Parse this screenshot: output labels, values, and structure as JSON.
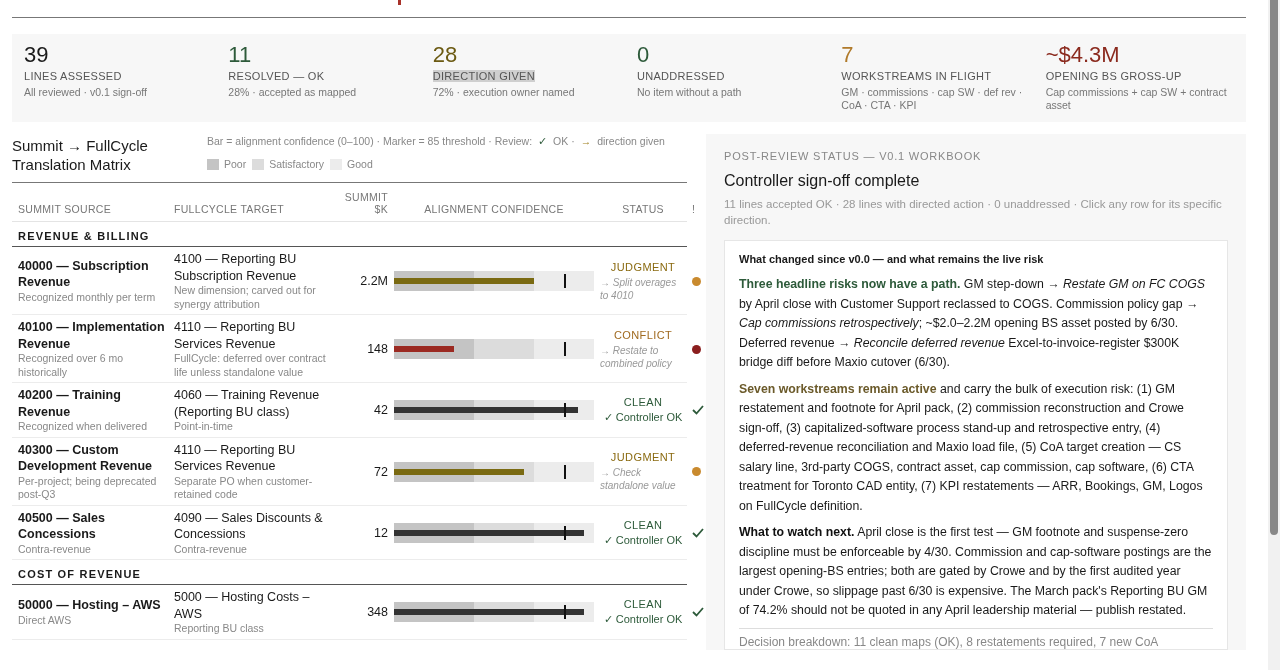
{
  "kpis": [
    {
      "value": "39",
      "label": "LINES ASSESSED",
      "note": "All reviewed · v0.1 sign-off",
      "color": "#1a1a1a",
      "highlighted": false
    },
    {
      "value": "11",
      "label": "RESOLVED — OK",
      "note": "28% · accepted as mapped",
      "color": "#2d5a3a",
      "highlighted": false
    },
    {
      "value": "28",
      "label": "DIRECTION GIVEN",
      "note": "72% · execution owner named",
      "color": "#6b5a12",
      "highlighted": true
    },
    {
      "value": "0",
      "label": "UNADDRESSED",
      "note": "No item without a path",
      "color": "#2d5a3a",
      "highlighted": false
    },
    {
      "value": "7",
      "label": "WORKSTREAMS IN FLIGHT",
      "note": "GM · commissions · cap SW · def rev · CoA · CTA · KPI",
      "color": "#b07a2a",
      "highlighted": false
    },
    {
      "value": "~$4.3M",
      "label": "OPENING BS GROSS-UP",
      "note": "Cap commissions + cap SW + contract asset",
      "color": "#8b2a1e",
      "highlighted": false
    }
  ],
  "matrix": {
    "title": "Summit → FullCycle Translation Matrix",
    "legend": [
      "Bar = alignment confidence (0–100) · Marker = 85 threshold · Review:",
      "✓",
      "OK ·",
      "→",
      "direction given"
    ],
    "bands": [
      {
        "label": "Poor",
        "color": "#c4c4c4"
      },
      {
        "label": "Satisfactory",
        "color": "#dcdcdc"
      },
      {
        "label": "Good",
        "color": "#ececec"
      }
    ],
    "columns": [
      "SUMMIT SOURCE",
      "FULLCYCLE TARGET",
      "SUMMIT $K",
      "ALIGNMENT CONFIDENCE",
      "STATUS",
      "!"
    ],
    "sections": [
      {
        "title": "REVENUE & BILLING",
        "rows": [
          {
            "source": "40000 — Subscription Revenue",
            "source_note": "Recognized monthly per term",
            "target": "4100 — Reporting BU Subscription Revenue",
            "target_note": "New dimension; carved out for synergy attribution",
            "amount": "2.2M",
            "level": 0.7,
            "status": "JUDGMENT",
            "kind": "judgment",
            "direction": "→ Split overages to 4010"
          },
          {
            "source": "40100 — Implementation Revenue",
            "source_note": "Recognized over 6 mo historically",
            "target": "4110 — Reporting BU Services Revenue",
            "target_note": "FullCycle: deferred over contract life unless standalone value",
            "amount": "148",
            "level": 0.3,
            "status": "CONFLICT",
            "kind": "conflict",
            "direction": "→ Restate to combined policy"
          },
          {
            "source": "40200 — Training Revenue",
            "source_note": "Recognized when delivered",
            "target": "4060 — Training Revenue (Reporting BU class)",
            "target_note": "Point-in-time",
            "amount": "42",
            "level": 0.92,
            "status": "CLEAN",
            "kind": "clean",
            "direction": "✓ Controller OK"
          },
          {
            "source": "40300 — Custom Development Revenue",
            "source_note": "Per-project; being deprecated post-Q3",
            "target": "4110 — Reporting BU Services Revenue",
            "target_note": "Separate PO when customer-retained code",
            "amount": "72",
            "level": 0.65,
            "status": "JUDGMENT",
            "kind": "judgment",
            "direction": "→ Check standalone value"
          },
          {
            "source": "40500 — Sales Concessions",
            "source_note": "Contra-revenue",
            "target": "4090 — Sales Discounts & Concessions",
            "target_note": "Contra-revenue",
            "amount": "12",
            "level": 0.95,
            "status": "CLEAN",
            "kind": "clean",
            "direction": "✓ Controller OK"
          }
        ]
      },
      {
        "title": "COST OF REVENUE",
        "rows": [
          {
            "source": "50000 — Hosting – AWS",
            "source_note": "Direct AWS",
            "target": "5000 — Hosting Costs – AWS",
            "target_note": "Reporting BU class",
            "amount": "348",
            "level": 0.95,
            "status": "CLEAN",
            "kind": "clean",
            "direction": "✓ Controller OK"
          }
        ]
      }
    ]
  },
  "panel": {
    "eyebrow": "POST-REVIEW STATUS — V0.1 WORKBOOK",
    "title": "Controller sign-off complete",
    "summary": "11 lines accepted OK · 28 lines with directed action · 0 unaddressed · Click any row for its specific direction.",
    "box_title": "What changed since v0.0 — and what remains the live risk",
    "paragraphs": [
      {
        "kind": "resolved",
        "text": "**Three headline risks now have a path.** GM step-down → *Restate GM on FC COGS* by April close with Customer Support reclassed to COGS. Commission policy gap → *Cap commissions retrospectively*; ~$2.0–2.2M opening BS asset posted by 6/30. Deferred revenue → *Reconcile deferred revenue* Excel-to-invoice-register $300K bridge diff before Maxio cutover (6/30)."
      },
      {
        "kind": "active",
        "text": "**Seven workstreams remain active** and carry the bulk of execution risk: (1) GM restatement and footnote for April pack, (2) commission reconstruction and Crowe sign-off, (3) capitalized-software process stand-up and retrospective entry, (4) deferred-revenue reconciliation and Maxio load file, (5) CoA target creation — CS salary line, 3rd-party COGS, contract asset, cap commission, cap software, (6) CTA treatment for Toronto CAD entity, (7) KPI restatements — ARR, Bookings, GM, Logos on FullCycle definition."
      },
      {
        "kind": "watch",
        "text": "**What to watch next.** April close is the first test — GM footnote and suspense-zero discipline must be enforceable by 4/30. Commission and cap-software postings are the largest opening-BS entries; both are gated by Crowe and by the first audited year under Crowe, so slippage past 6/30 is expensive. The March pack's Reporting BU GM of 74.2% should not be quoted in any April leadership material — publish restated."
      }
    ],
    "footer": "Decision breakdown: 11 clean maps (OK), 8 restatements required, 7 new CoA"
  }
}
